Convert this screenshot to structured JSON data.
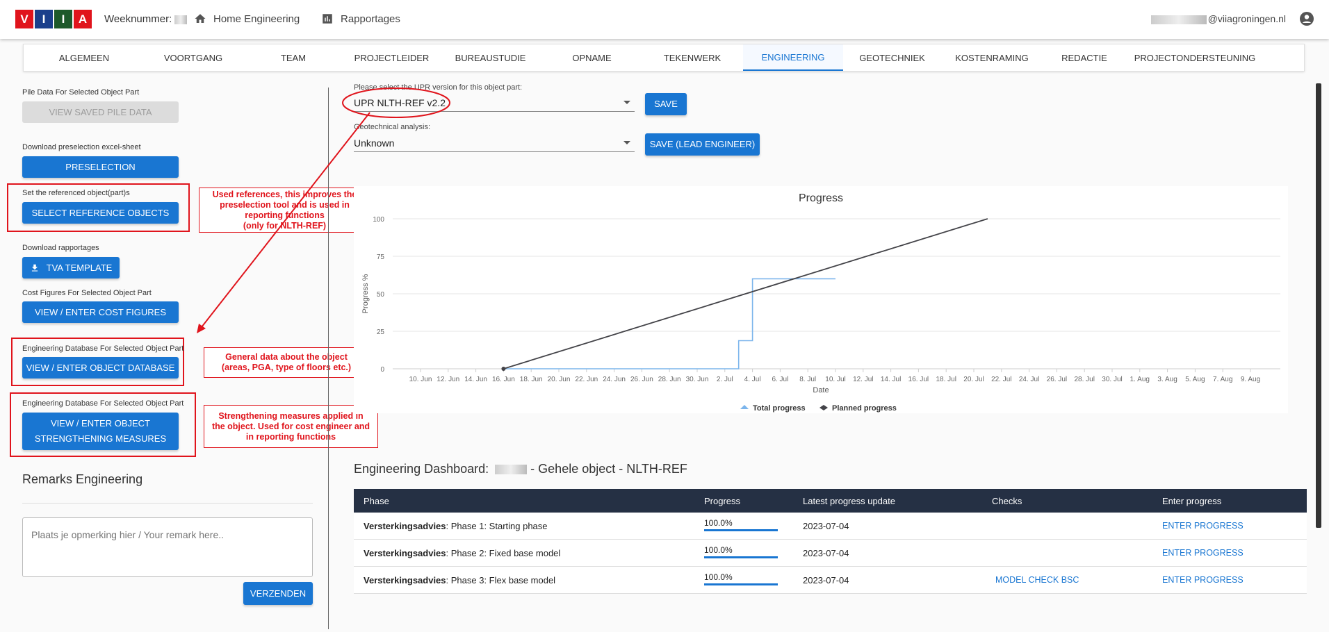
{
  "header": {
    "logo_letters": [
      "V",
      "I",
      "I",
      "A"
    ],
    "logo_colors": [
      "#e0141c",
      "#1b3f8b",
      "#1e5a2b",
      "#e0141c"
    ],
    "week_label": "Weeknummer:",
    "nav": [
      {
        "label": "Home Engineering",
        "icon": "home-icon"
      },
      {
        "label": "Rapportages",
        "icon": "bar-chart-icon"
      }
    ],
    "user_email_suffix": "@viiagroningen.nl",
    "account_icon": "account-circle-icon"
  },
  "tabs": [
    {
      "label": "ALGEMEEN",
      "active": false
    },
    {
      "label": "VOORTGANG",
      "active": false
    },
    {
      "label": "TEAM",
      "active": false
    },
    {
      "label": "PROJECTLEIDER",
      "active": false
    },
    {
      "label": "BUREAUSTUDIE",
      "active": false
    },
    {
      "label": "OPNAME",
      "active": false
    },
    {
      "label": "TEKENWERK",
      "active": false
    },
    {
      "label": "ENGINEERING",
      "active": true
    },
    {
      "label": "GEOTECHNIEK",
      "active": false
    },
    {
      "label": "KOSTENRAMING",
      "active": false
    },
    {
      "label": "REDACTIE",
      "active": false
    },
    {
      "label": "PROJECTONDERSTEUNING",
      "active": false
    }
  ],
  "left": {
    "pile_label": "Pile Data For Selected Object Part",
    "pile_button": "VIEW SAVED PILE DATA",
    "preselection_label": "Download preselection excel-sheet",
    "preselection_button": "PRESELECTION",
    "reference_label": "Set the referenced object(part)s",
    "reference_button": "SELECT REFERENCE OBJECTS",
    "rapportages_label": "Download rapportages",
    "tva_button": "TVA TEMPLATE",
    "cost_label": "Cost Figures For Selected Object Part",
    "cost_button": "VIEW / ENTER COST FIGURES",
    "db_label": "Engineering Database For Selected Object Part",
    "db_button": "VIEW / ENTER OBJECT DATABASE",
    "measures_label": "Engineering Database For Selected Object Part",
    "measures_button_line1": "VIEW / ENTER OBJECT",
    "measures_button_line2": "STRENGTHENING MEASURES",
    "remarks_title": "Remarks Engineering",
    "remarks_placeholder": "Plaats je opmerking hier / Your remark here..",
    "send_button": "VERZENDEN"
  },
  "annotations": {
    "references_lines": [
      "Used references, this improves the",
      "preselection tool and is used in",
      "reporting functions",
      "(only for NLTH-REF)"
    ],
    "general_lines": [
      "General data about the object",
      "(areas, PGA, type of floors etc.)"
    ],
    "strengthening_lines": [
      "Strengthening measures applied in",
      "the object. Used for cost engineer and",
      "in reporting functions"
    ],
    "color": "#e0141c"
  },
  "form": {
    "upr_label": "Please select the UPR version for this object part:",
    "upr_value": "UPR NLTH-REF v2.2",
    "save_button": "SAVE",
    "geo_label": "Geotechnical analysis:",
    "geo_value": "Unknown",
    "save_lead_button": "SAVE (LEAD ENGINEER)"
  },
  "chart_data": {
    "type": "line",
    "title": "Progress",
    "xlabel": "Date",
    "ylabel": "Progress %",
    "x_ticks": [
      "10. Jun",
      "12. Jun",
      "14. Jun",
      "16. Jun",
      "18. Jun",
      "20. Jun",
      "22. Jun",
      "24. Jun",
      "26. Jun",
      "28. Jun",
      "30. Jun",
      "2. Jul",
      "4. Jul",
      "6. Jul",
      "8. Jul",
      "10. Jul",
      "12. Jul",
      "14. Jul",
      "16. Jul",
      "18. Jul",
      "20. Jul",
      "22. Jul",
      "24. Jul",
      "26. Jul",
      "28. Jul",
      "30. Jul",
      "1. Aug",
      "3. Aug",
      "5. Aug",
      "7. Aug",
      "9. Aug"
    ],
    "y_ticks": [
      0,
      25,
      50,
      75,
      100
    ],
    "ylim": [
      0,
      100
    ],
    "grid": true,
    "legend_placement": "bottom",
    "series": [
      {
        "name": "Total progress",
        "color": "#7cb5ec",
        "step": true,
        "points": [
          [
            "2023-06-16",
            0
          ],
          [
            "2023-07-03",
            0
          ],
          [
            "2023-07-03",
            18.75
          ],
          [
            "2023-07-04",
            18.75
          ],
          [
            "2023-07-04",
            60
          ],
          [
            "2023-07-10",
            60
          ]
        ]
      },
      {
        "name": "Planned progress",
        "color": "#434348",
        "step": false,
        "points": [
          [
            "2023-06-16",
            0
          ],
          [
            "2023-07-21",
            100
          ]
        ]
      }
    ]
  },
  "dashboard": {
    "title_prefix": "Engineering Dashboard:",
    "title_suffix": "- Gehele object - NLTH-REF",
    "columns": [
      "Phase",
      "Progress",
      "Latest progress update",
      "Checks",
      "Enter progress"
    ],
    "rows": [
      {
        "phase_bold": "Versterkingsadvies",
        "phase_rest": ": Phase 1: Starting phase",
        "progress": "100.0%",
        "progress_value": 1.0,
        "date": "2023-07-04",
        "check": "",
        "action": "ENTER PROGRESS"
      },
      {
        "phase_bold": "Versterkingsadvies",
        "phase_rest": ": Phase 2: Fixed base model",
        "progress": "100.0%",
        "progress_value": 1.0,
        "date": "2023-07-04",
        "check": "",
        "action": "ENTER PROGRESS"
      },
      {
        "phase_bold": "Versterkingsadvies",
        "phase_rest": ": Phase 3: Flex base model",
        "progress": "100.0%",
        "progress_value": 1.0,
        "date": "2023-07-04",
        "check": "MODEL CHECK BSC",
        "action": "ENTER PROGRESS"
      }
    ]
  }
}
